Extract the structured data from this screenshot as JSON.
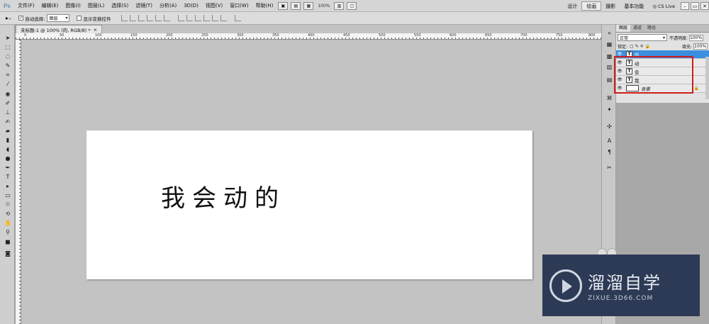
{
  "app": {
    "logo": "Ps",
    "menu": [
      "文件(F)",
      "编辑(E)",
      "图像(I)",
      "图层(L)",
      "选择(S)",
      "滤镜(T)",
      "分析(A)",
      "3D(D)",
      "视图(V)",
      "窗口(W)",
      "帮助(H)"
    ],
    "zoom": "100%",
    "workspaces": [
      "设计",
      "绘画",
      "摄影",
      "基本功能"
    ],
    "active_workspace": "绘画",
    "cs_live": "CS Live"
  },
  "options": {
    "auto_select_label": "自动选择:",
    "auto_select_value": "图层",
    "show_transform_label": "显示变换控件",
    "auto_select_checked": true,
    "show_transform_checked": false
  },
  "document": {
    "tab_title": "未标题-1 @ 100% (的, RGB/8) *",
    "ruler_numbers": [
      "0",
      "50",
      "100",
      "150",
      "200",
      "250",
      "300",
      "350",
      "400",
      "450",
      "500",
      "550",
      "600",
      "650",
      "700",
      "750",
      "800"
    ],
    "canvas_text": "我会动的"
  },
  "layers_panel": {
    "tabs": [
      "图层",
      "通道",
      "路径"
    ],
    "active_tab": "图层",
    "blend_mode": "正常",
    "opacity_label": "不透明度:",
    "opacity_value": "100%",
    "lock_label": "锁定:",
    "fill_label": "填充:",
    "fill_value": "100%",
    "layers": [
      {
        "name": "的",
        "type": "text",
        "selected": true
      },
      {
        "name": "动",
        "type": "text",
        "selected": false
      },
      {
        "name": "会",
        "type": "text",
        "selected": false
      },
      {
        "name": "我",
        "type": "text",
        "selected": false
      },
      {
        "name": "背景",
        "type": "background",
        "selected": false,
        "locked": true
      }
    ],
    "highlight_color": "#d01c1c"
  },
  "watermark": {
    "title": "溜溜自学",
    "url": "ZIXUE.3D66.COM"
  }
}
